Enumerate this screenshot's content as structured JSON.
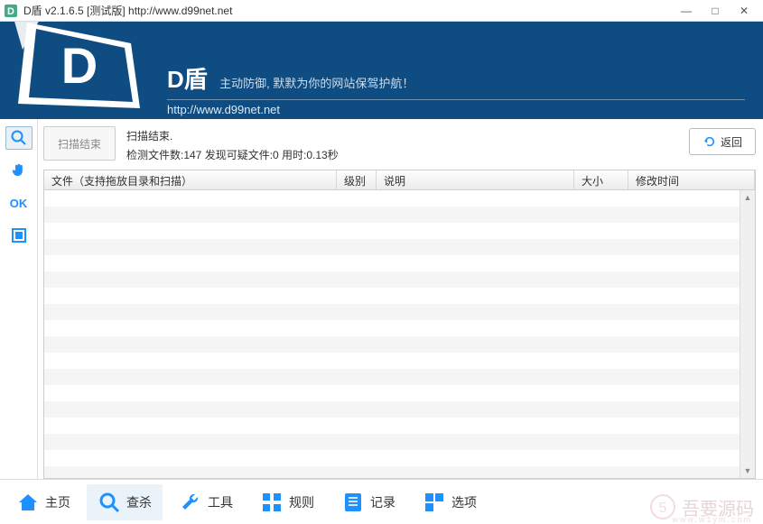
{
  "window": {
    "title": "D盾 v2.1.6.5 [测试版] http://www.d99net.net"
  },
  "banner": {
    "app_name": "D盾",
    "slogan": "主动防御, 默默为你的网站保驾护航！",
    "url": "http://www.d99net.net"
  },
  "side": {
    "search": "search-icon",
    "hand": "hand-icon",
    "ok": "OK",
    "square": "square-icon"
  },
  "status": {
    "scan_end_btn": "扫描结束",
    "line1": "扫描结束.",
    "line2": "检测文件数:147 发现可疑文件:0 用时:0.13秒",
    "back_btn": "返回"
  },
  "table": {
    "headers": {
      "file": "文件（支持拖放目录和扫描）",
      "level": "级别",
      "desc": "说明",
      "size": "大小",
      "time": "修改时间"
    },
    "rows": []
  },
  "nav": {
    "home": "主页",
    "scan": "查杀",
    "tools": "工具",
    "rules": "规则",
    "record": "记录",
    "options": "选项"
  },
  "watermark": {
    "text": "吾要源码",
    "sub": "www.w1ym.com"
  },
  "colors": {
    "banner_bg": "#0f4c81",
    "accent": "#1e90ff"
  }
}
